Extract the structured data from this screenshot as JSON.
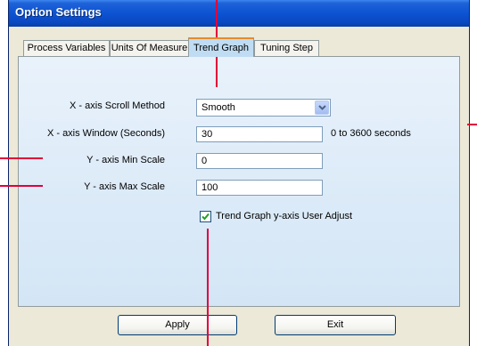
{
  "window": {
    "title": "Option Settings"
  },
  "tabs": [
    {
      "label": "Process Variables"
    },
    {
      "label": "Units Of Measure"
    },
    {
      "label": "Trend Graph"
    },
    {
      "label": "Tuning Step"
    }
  ],
  "active_tab": "Trend Graph",
  "form": {
    "scroll_method": {
      "label": "X - axis Scroll Method",
      "value": "Smooth"
    },
    "x_window": {
      "label": "X - axis Window (Seconds)",
      "value": "30",
      "hint": "0 to 3600 seconds"
    },
    "y_min": {
      "label": "Y - axis Min Scale",
      "value": "0"
    },
    "y_max": {
      "label": "Y - axis Max Scale",
      "value": "100"
    },
    "user_adjust": {
      "label": "Trend Graph y-axis User Adjust",
      "checked": true
    }
  },
  "buttons": {
    "apply": "Apply",
    "exit": "Exit"
  },
  "colors": {
    "titlebar": "#0a48c0",
    "callout": "#e0003c",
    "panel": "#dbeaf8",
    "active_tab_accent": "#e68b2c"
  }
}
